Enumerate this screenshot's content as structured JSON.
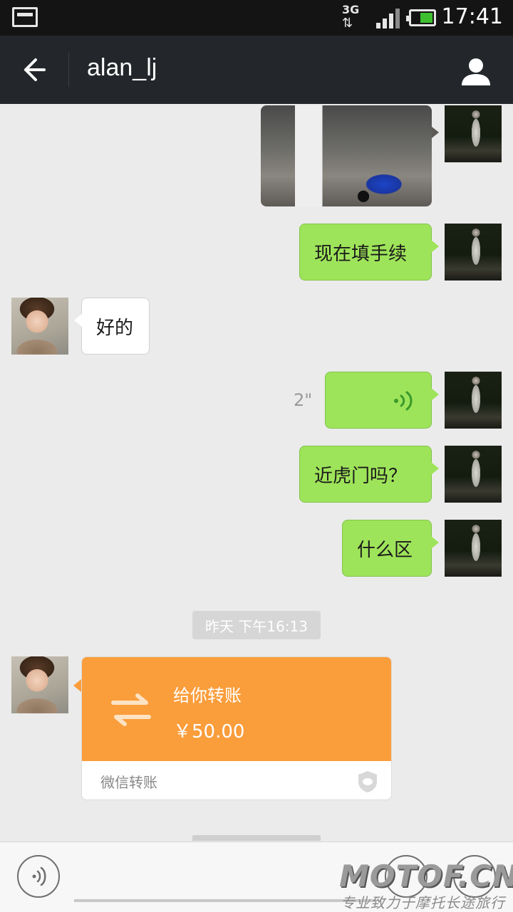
{
  "status_bar": {
    "network_type": "3G",
    "network_arrows": "⇅",
    "time": "17:41",
    "battery_level": 0.6
  },
  "header": {
    "title": "alan_lj",
    "back_icon": "arrow-left-icon",
    "profile_icon": "person-icon"
  },
  "messages": [
    {
      "sender": "self",
      "type": "image"
    },
    {
      "sender": "self",
      "type": "text",
      "text": "现在填手续"
    },
    {
      "sender": "other",
      "type": "text",
      "text": "好的"
    },
    {
      "sender": "self",
      "type": "voice",
      "duration": "2\""
    },
    {
      "sender": "self",
      "type": "text",
      "text": "近虎门吗？"
    },
    {
      "sender": "self",
      "type": "text",
      "text": "什么区"
    }
  ],
  "timestamp": "昨天 下午16:13",
  "transfer": {
    "title": "给你转账",
    "amount": "￥50.00",
    "footer": "微信转账",
    "color": "#fa9d3b"
  },
  "watermark": {
    "logo": "MOTOF.CN",
    "tagline": "专业致力于摩托长途旅行"
  },
  "colors": {
    "self_bubble": "#9ee45a",
    "other_bubble": "#ffffff",
    "titlebar": "#23272b",
    "background": "#ebebeb"
  }
}
